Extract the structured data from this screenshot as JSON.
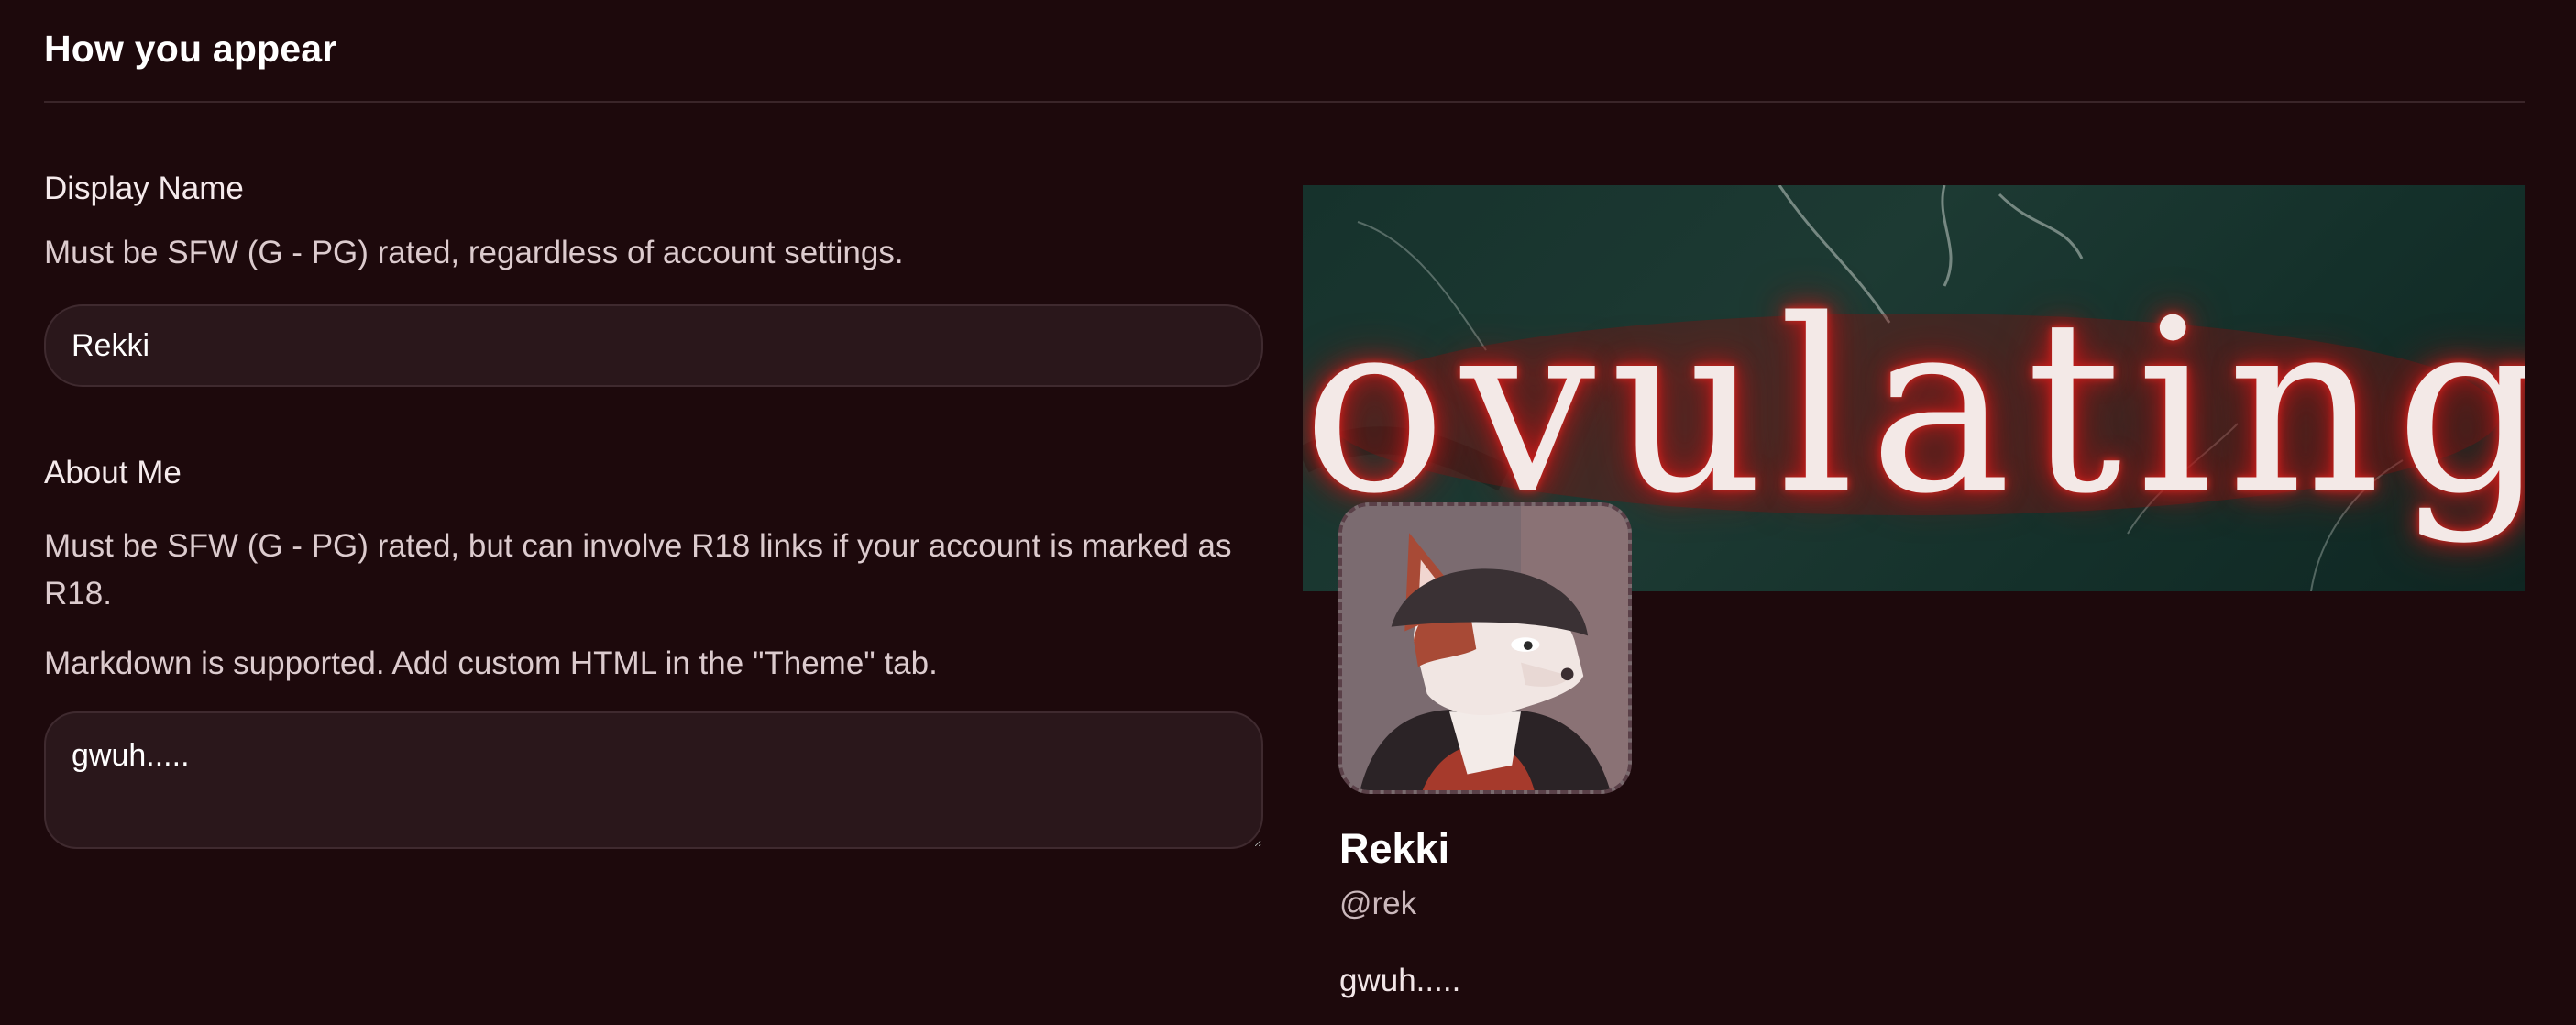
{
  "section": {
    "title": "How you appear"
  },
  "display_name": {
    "label": "Display Name",
    "help": "Must be SFW (G - PG) rated, regardless of account settings.",
    "value": "Rekki"
  },
  "about_me": {
    "label": "About Me",
    "help": "Must be SFW (G - PG) rated, but can involve R18 links if your account is marked as R18.",
    "markdown_note": "Markdown is supported. Add custom HTML in the \"Theme\" tab.",
    "value": "gwuh....."
  },
  "preview": {
    "banner_text": "ovulating",
    "name": "Rekki",
    "handle": "@rek",
    "bio": "gwuh....."
  },
  "colors": {
    "background": "#1d090c",
    "input_bg": "#2a171b",
    "banner_glow": "#c21b1b"
  }
}
